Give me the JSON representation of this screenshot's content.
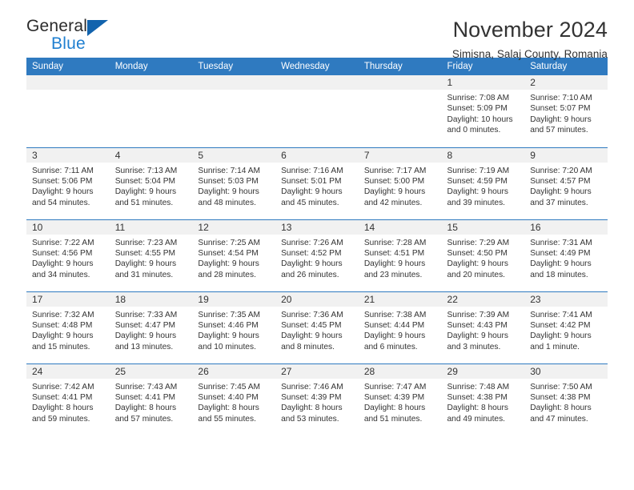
{
  "logo": {
    "word_top": "General",
    "word_bottom": "Blue",
    "triangle_color": "#1263ad",
    "blue_color": "#1f7fd0"
  },
  "header": {
    "title": "November 2024",
    "subtitle": "Simisna, Salaj County, Romania"
  },
  "theme": {
    "header_band": "#2f7ac0",
    "daynum_band": "#f1f1f1",
    "text": "#333333"
  },
  "calendar": {
    "weekdays": [
      "Sunday",
      "Monday",
      "Tuesday",
      "Wednesday",
      "Thursday",
      "Friday",
      "Saturday"
    ],
    "weeks": [
      [
        {
          "day": "",
          "empty": true
        },
        {
          "day": "",
          "empty": true
        },
        {
          "day": "",
          "empty": true
        },
        {
          "day": "",
          "empty": true
        },
        {
          "day": "",
          "empty": true
        },
        {
          "day": "1",
          "sunrise": "Sunrise: 7:08 AM",
          "sunset": "Sunset: 5:09 PM",
          "daylight": "Daylight: 10 hours and 0 minutes."
        },
        {
          "day": "2",
          "sunrise": "Sunrise: 7:10 AM",
          "sunset": "Sunset: 5:07 PM",
          "daylight": "Daylight: 9 hours and 57 minutes."
        }
      ],
      [
        {
          "day": "3",
          "sunrise": "Sunrise: 7:11 AM",
          "sunset": "Sunset: 5:06 PM",
          "daylight": "Daylight: 9 hours and 54 minutes."
        },
        {
          "day": "4",
          "sunrise": "Sunrise: 7:13 AM",
          "sunset": "Sunset: 5:04 PM",
          "daylight": "Daylight: 9 hours and 51 minutes."
        },
        {
          "day": "5",
          "sunrise": "Sunrise: 7:14 AM",
          "sunset": "Sunset: 5:03 PM",
          "daylight": "Daylight: 9 hours and 48 minutes."
        },
        {
          "day": "6",
          "sunrise": "Sunrise: 7:16 AM",
          "sunset": "Sunset: 5:01 PM",
          "daylight": "Daylight: 9 hours and 45 minutes."
        },
        {
          "day": "7",
          "sunrise": "Sunrise: 7:17 AM",
          "sunset": "Sunset: 5:00 PM",
          "daylight": "Daylight: 9 hours and 42 minutes."
        },
        {
          "day": "8",
          "sunrise": "Sunrise: 7:19 AM",
          "sunset": "Sunset: 4:59 PM",
          "daylight": "Daylight: 9 hours and 39 minutes."
        },
        {
          "day": "9",
          "sunrise": "Sunrise: 7:20 AM",
          "sunset": "Sunset: 4:57 PM",
          "daylight": "Daylight: 9 hours and 37 minutes."
        }
      ],
      [
        {
          "day": "10",
          "sunrise": "Sunrise: 7:22 AM",
          "sunset": "Sunset: 4:56 PM",
          "daylight": "Daylight: 9 hours and 34 minutes."
        },
        {
          "day": "11",
          "sunrise": "Sunrise: 7:23 AM",
          "sunset": "Sunset: 4:55 PM",
          "daylight": "Daylight: 9 hours and 31 minutes."
        },
        {
          "day": "12",
          "sunrise": "Sunrise: 7:25 AM",
          "sunset": "Sunset: 4:54 PM",
          "daylight": "Daylight: 9 hours and 28 minutes."
        },
        {
          "day": "13",
          "sunrise": "Sunrise: 7:26 AM",
          "sunset": "Sunset: 4:52 PM",
          "daylight": "Daylight: 9 hours and 26 minutes."
        },
        {
          "day": "14",
          "sunrise": "Sunrise: 7:28 AM",
          "sunset": "Sunset: 4:51 PM",
          "daylight": "Daylight: 9 hours and 23 minutes."
        },
        {
          "day": "15",
          "sunrise": "Sunrise: 7:29 AM",
          "sunset": "Sunset: 4:50 PM",
          "daylight": "Daylight: 9 hours and 20 minutes."
        },
        {
          "day": "16",
          "sunrise": "Sunrise: 7:31 AM",
          "sunset": "Sunset: 4:49 PM",
          "daylight": "Daylight: 9 hours and 18 minutes."
        }
      ],
      [
        {
          "day": "17",
          "sunrise": "Sunrise: 7:32 AM",
          "sunset": "Sunset: 4:48 PM",
          "daylight": "Daylight: 9 hours and 15 minutes."
        },
        {
          "day": "18",
          "sunrise": "Sunrise: 7:33 AM",
          "sunset": "Sunset: 4:47 PM",
          "daylight": "Daylight: 9 hours and 13 minutes."
        },
        {
          "day": "19",
          "sunrise": "Sunrise: 7:35 AM",
          "sunset": "Sunset: 4:46 PM",
          "daylight": "Daylight: 9 hours and 10 minutes."
        },
        {
          "day": "20",
          "sunrise": "Sunrise: 7:36 AM",
          "sunset": "Sunset: 4:45 PM",
          "daylight": "Daylight: 9 hours and 8 minutes."
        },
        {
          "day": "21",
          "sunrise": "Sunrise: 7:38 AM",
          "sunset": "Sunset: 4:44 PM",
          "daylight": "Daylight: 9 hours and 6 minutes."
        },
        {
          "day": "22",
          "sunrise": "Sunrise: 7:39 AM",
          "sunset": "Sunset: 4:43 PM",
          "daylight": "Daylight: 9 hours and 3 minutes."
        },
        {
          "day": "23",
          "sunrise": "Sunrise: 7:41 AM",
          "sunset": "Sunset: 4:42 PM",
          "daylight": "Daylight: 9 hours and 1 minute."
        }
      ],
      [
        {
          "day": "24",
          "sunrise": "Sunrise: 7:42 AM",
          "sunset": "Sunset: 4:41 PM",
          "daylight": "Daylight: 8 hours and 59 minutes."
        },
        {
          "day": "25",
          "sunrise": "Sunrise: 7:43 AM",
          "sunset": "Sunset: 4:41 PM",
          "daylight": "Daylight: 8 hours and 57 minutes."
        },
        {
          "day": "26",
          "sunrise": "Sunrise: 7:45 AM",
          "sunset": "Sunset: 4:40 PM",
          "daylight": "Daylight: 8 hours and 55 minutes."
        },
        {
          "day": "27",
          "sunrise": "Sunrise: 7:46 AM",
          "sunset": "Sunset: 4:39 PM",
          "daylight": "Daylight: 8 hours and 53 minutes."
        },
        {
          "day": "28",
          "sunrise": "Sunrise: 7:47 AM",
          "sunset": "Sunset: 4:39 PM",
          "daylight": "Daylight: 8 hours and 51 minutes."
        },
        {
          "day": "29",
          "sunrise": "Sunrise: 7:48 AM",
          "sunset": "Sunset: 4:38 PM",
          "daylight": "Daylight: 8 hours and 49 minutes."
        },
        {
          "day": "30",
          "sunrise": "Sunrise: 7:50 AM",
          "sunset": "Sunset: 4:38 PM",
          "daylight": "Daylight: 8 hours and 47 minutes."
        }
      ]
    ]
  }
}
